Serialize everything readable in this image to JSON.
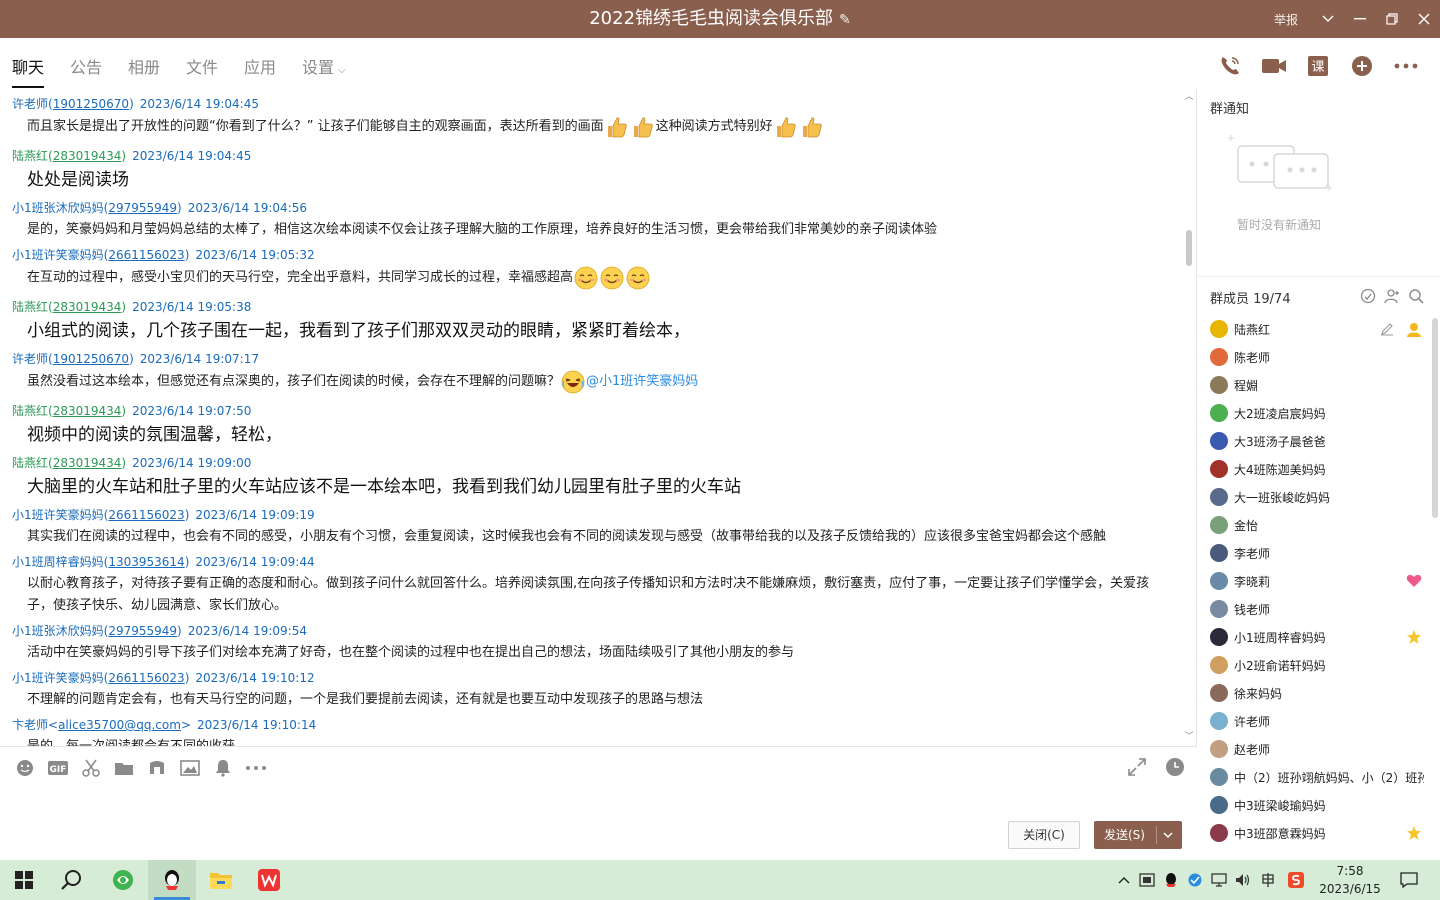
{
  "window": {
    "title": "2022锦绣毛毛虫阅读会俱乐部",
    "report_label": "举报"
  },
  "tabs": [
    {
      "label": "聊天",
      "active": true
    },
    {
      "label": "公告"
    },
    {
      "label": "相册"
    },
    {
      "label": "文件"
    },
    {
      "label": "应用"
    },
    {
      "label": "设置"
    }
  ],
  "messages": [
    {
      "name": "许老师",
      "uid": "1901250670",
      "time": "2023/6/14 19:04:45",
      "color": "blue",
      "text": "而且家长是提出了开放性的问题“你看到了什么？” 让孩子们能够自主的观察画面，表达所看到的画面",
      "text2": "这种阅读方式特别好",
      "style": "normal"
    },
    {
      "name": "陆燕红",
      "uid": "283019434",
      "time": "2023/6/14 19:04:45",
      "color": "green",
      "text": "处处是阅读场",
      "style": "big"
    },
    {
      "name": "小1班张沐欣妈妈",
      "uid": "297955949",
      "time": "2023/6/14 19:04:56",
      "color": "blue",
      "text": "是的，笑豪妈妈和月莹妈妈总结的太棒了，相信这次绘本阅读不仅会让孩子理解大脑的工作原理，培养良好的生活习惯，更会带给我们非常美妙的亲子阅读体验",
      "style": "normal"
    },
    {
      "name": "小1班许笑豪妈妈",
      "uid": "2661156023",
      "time": "2023/6/14 19:05:32",
      "color": "blue",
      "text": "在互动的过程中，感受小宝贝们的天马行空，完全出乎意料，共同学习成长的过程，幸福感超高",
      "style": "normal"
    },
    {
      "name": "陆燕红",
      "uid": "283019434",
      "time": "2023/6/14 19:05:38",
      "color": "green",
      "text": "小组式的阅读，几个孩子围在一起，我看到了孩子们那双双灵动的眼睛，紧紧盯着绘本，",
      "style": "big"
    },
    {
      "name": "许老师",
      "uid": "1901250670",
      "time": "2023/6/14 19:07:17",
      "color": "blue",
      "text": "虽然没看过这本绘本，但感觉还有点深奥的，孩子们在阅读的时候，会存在不理解的问题嘛？",
      "at": "@小1班许笑豪妈妈",
      "style": "normal"
    },
    {
      "name": "陆燕红",
      "uid": "283019434",
      "time": "2023/6/14 19:07:50",
      "color": "green",
      "text": "视频中的阅读的氛围温馨，轻松，",
      "style": "big"
    },
    {
      "name": "陆燕红",
      "uid": "283019434",
      "time": "2023/6/14 19:09:00",
      "color": "green",
      "text": "大脑里的火车站和肚子里的火车站应该不是一本绘本吧，我看到我们幼儿园里有肚子里的火车站",
      "style": "big"
    },
    {
      "name": "小1班许笑豪妈妈",
      "uid": "2661156023",
      "time": "2023/6/14 19:09:19",
      "color": "blue",
      "text": "其实我们在阅读的过程中，也会有不同的感受，小朋友有个习惯，会重复阅读，这时候我也会有不同的阅读发现与感受（故事带给我的以及孩子反馈给我的）应该很多宝爸宝妈都会这个感触",
      "style": "normal"
    },
    {
      "name": "小1班周梓睿妈妈",
      "uid": "1303953614",
      "time": "2023/6/14 19:09:44",
      "color": "blue",
      "text": "以耐心教育孩子，对待孩子要有正确的态度和耐心。做到孩子问什么就回答什么。培养阅读氛围,在向孩子传播知识和方法时决不能嫌麻烦，敷衍塞责，应付了事，一定要让孩子们学懂学会，关爱孩子，使孩子快乐、幼儿园满意、家长们放心。",
      "style": "normal"
    },
    {
      "name": "小1班张沐欣妈妈",
      "uid": "297955949",
      "time": "2023/6/14 19:09:54",
      "color": "blue",
      "text": "活动中在笑豪妈妈的引导下孩子们对绘本充满了好奇，也在整个阅读的过程中也在提出自己的想法，场面陆续吸引了其他小朋友的参与",
      "style": "normal"
    },
    {
      "name": "小1班许笑豪妈妈",
      "uid": "2661156023",
      "time": "2023/6/14 19:10:12",
      "color": "blue",
      "text": "不理解的问题肯定会有，也有天马行空的问题，一个是我们要提前去阅读，还有就是也要互动中发现孩子的思路与想法",
      "style": "normal"
    },
    {
      "name": "卞老师",
      "uid": "alice35700@qq.com",
      "time": "2023/6/14 19:10:14",
      "color": "blue",
      "bracket": "angle",
      "text": "是的，每一次阅读都会有不同的收获",
      "style": "normal"
    }
  ],
  "input": {
    "close_label": "关闭(C)",
    "send_label": "发送(S)"
  },
  "side": {
    "notice_title": "群通知",
    "notice_empty": "暂时没有新通知",
    "members_title": "群成员 19/74",
    "members": [
      {
        "name": "陆燕红",
        "color": "#e8b600",
        "badge": "owner"
      },
      {
        "name": "陈老师",
        "color": "#e06a3a"
      },
      {
        "name": "程婣",
        "color": "#8a7a5a"
      },
      {
        "name": "大2班凌启宸妈妈",
        "color": "#4caf50"
      },
      {
        "name": "大3班汤子晨爸爸",
        "color": "#3a5ab0"
      },
      {
        "name": "大4班陈迦美妈妈",
        "color": "#a0322a"
      },
      {
        "name": "大一班张峻屹妈妈",
        "color": "#5a6a8a"
      },
      {
        "name": "金怡",
        "color": "#7aa07a"
      },
      {
        "name": "李老师",
        "color": "#4a5a7a"
      },
      {
        "name": "李晓莉",
        "color": "#6a8aa8",
        "badge": "heart"
      },
      {
        "name": "钱老师",
        "color": "#7a8aa0"
      },
      {
        "name": "小1班周梓睿妈妈",
        "color": "#2a2a3a",
        "badge": "star"
      },
      {
        "name": "小2班俞诺轩妈妈",
        "color": "#d0a060"
      },
      {
        "name": "徐来妈妈",
        "color": "#8a6a5a"
      },
      {
        "name": "许老师",
        "color": "#7ab0d0"
      },
      {
        "name": "赵老师",
        "color": "#c0a080"
      },
      {
        "name": "中（2）班孙翊航妈妈、小（2）班孙",
        "color": "#6a8aa0"
      },
      {
        "name": "中3班梁峻瑜妈妈",
        "color": "#4a6a8a"
      },
      {
        "name": "中3班邵意霖妈妈",
        "color": "#8a3a4a",
        "badge": "star"
      }
    ]
  },
  "taskbar": {
    "time": "7:58",
    "date": "2023/6/15"
  }
}
